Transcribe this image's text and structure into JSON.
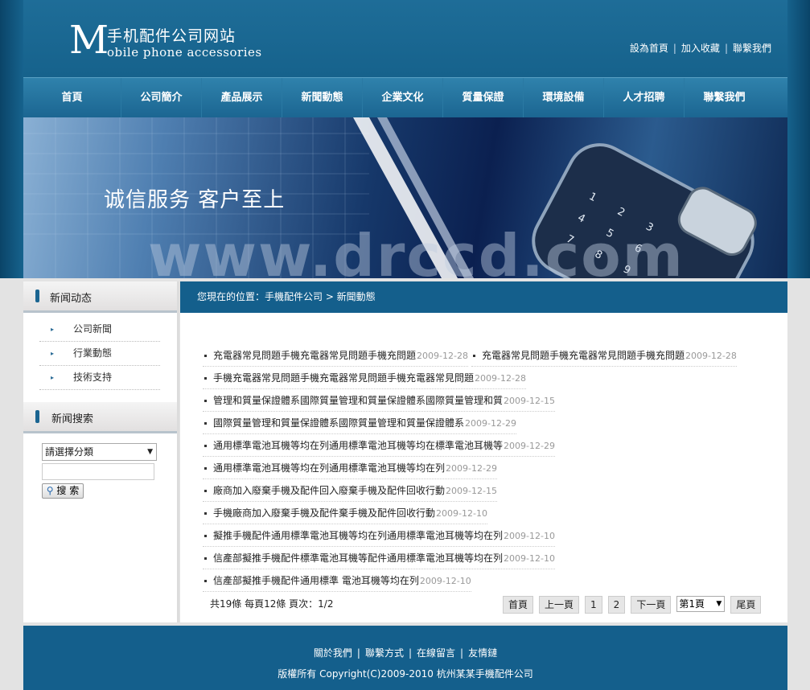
{
  "header": {
    "logo_m": "M",
    "logo_cn": "手机配件公司网站",
    "logo_en": "obile phone accessories",
    "toplinks": [
      "設為首頁",
      "加入收藏",
      "聯繫我們"
    ]
  },
  "nav": [
    "首頁",
    "公司簡介",
    "產品展示",
    "新聞動態",
    "企業文化",
    "質量保證",
    "環境設備",
    "人才招聘",
    "聯繫我們"
  ],
  "banner": {
    "slogan": "诚信服务  客户至上",
    "watermark": "www.drccd.com"
  },
  "sidebar": {
    "news_title": "新闻动态",
    "news_items": [
      "公司新聞",
      "行業動態",
      "技術支持"
    ],
    "search_title": "新闻搜索",
    "select_value": "請選擇分類",
    "search_button": "搜 索"
  },
  "main": {
    "breadcrumb": "您現在的位置：手機配件公司 > 新聞動態",
    "news": [
      [
        {
          "title": "充電器常見問題手機充電器常見問題手機充問題",
          "date": "2009-12-28"
        },
        {
          "title": "充電器常見問題手機充電器常見問題手機充問題",
          "date": "2009-12-28"
        }
      ],
      [
        {
          "title": "手機充電器常見問題手機充電器常見問題手機充電器常見問題",
          "date": "2009-12-28"
        }
      ],
      [
        {
          "title": "管理和質量保證體系國際質量管理和質量保證體系國際質量管理和質",
          "date": "2009-12-15"
        }
      ],
      [
        {
          "title": "國際質量管理和質量保證體系國際質量管理和質量保證體系",
          "date": "2009-12-29"
        }
      ],
      [
        {
          "title": "通用標準電池耳機等均在列通用標準電池耳機等均在標準電池耳機等",
          "date": "2009-12-29"
        }
      ],
      [
        {
          "title": "通用標準電池耳機等均在列通用標準電池耳機等均在列",
          "date": "2009-12-29"
        }
      ],
      [
        {
          "title": "廠商加入廢棄手機及配件回入廢棄手機及配件回收行動",
          "date": "2009-12-15"
        }
      ],
      [
        {
          "title": "手機廠商加入廢棄手機及配件棄手機及配件回收行動",
          "date": "2009-12-10"
        }
      ],
      [
        {
          "title": "擬推手機配件通用標準電池耳機等均在列通用標準電池耳機等均在列",
          "date": "2009-12-10"
        }
      ],
      [
        {
          "title": "信產部擬推手機配件標準電池耳機等配件通用標準電池耳機等均在列",
          "date": "2009-12-10"
        }
      ],
      [
        {
          "title": "信產部擬推手機配件通用標準 電池耳機等均在列",
          "date": "2009-12-10"
        }
      ]
    ],
    "pager_info": "共19條 每頁12條 頁次：1/2",
    "pager": {
      "first": "首頁",
      "prev": "上一頁",
      "p1": "1",
      "p2": "2",
      "next": "下一頁",
      "select": "第1頁",
      "last": "尾頁"
    }
  },
  "footer": {
    "links": [
      "關於我們",
      "聯繫方式",
      "在線留言",
      "友情鏈"
    ],
    "copyright": "版權所有 Copyright(C)2009-2010 杭州某某手機配件公司"
  }
}
